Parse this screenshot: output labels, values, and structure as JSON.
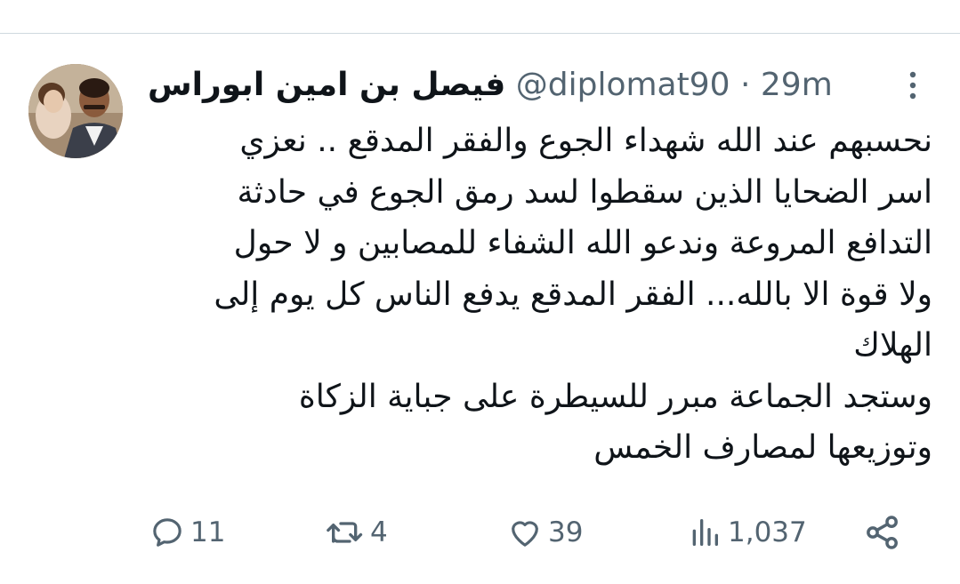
{
  "tweet": {
    "author_name": "فيصل بن امين ابوراس",
    "handle": "@diplomat90",
    "separator": "·",
    "time": "29m",
    "body_lines": [
      "نحسبهم عند الله شهداء الجوع والفقر المدقع .. نعزي",
      "اسر الضحايا الذين سقطوا لسد رمق الجوع في حادثة",
      "التدافع المروعة وندعو الله  الشفاء للمصابين  و لا حول",
      "ولا قوة الا بالله... الفقر المدقع يدفع الناس كل يوم إلى",
      "الهلاك",
      "وستجد الجماعة مبرر للسيطرة على جباية الزكاة",
      "وتوزيعها لمصارف الخمس"
    ]
  },
  "actions": {
    "replies": "11",
    "reposts": "4",
    "likes": "39",
    "views": "1,037"
  },
  "icons": {
    "reply": "speech-bubble-icon",
    "repost": "repost-arrows-icon",
    "like": "heart-icon",
    "views": "bar-chart-icon",
    "share": "share-icon",
    "more": "vertical-dots-icon"
  },
  "colors": {
    "text": "#0f1419",
    "secondary": "#536471",
    "divider": "#cfd9de"
  }
}
